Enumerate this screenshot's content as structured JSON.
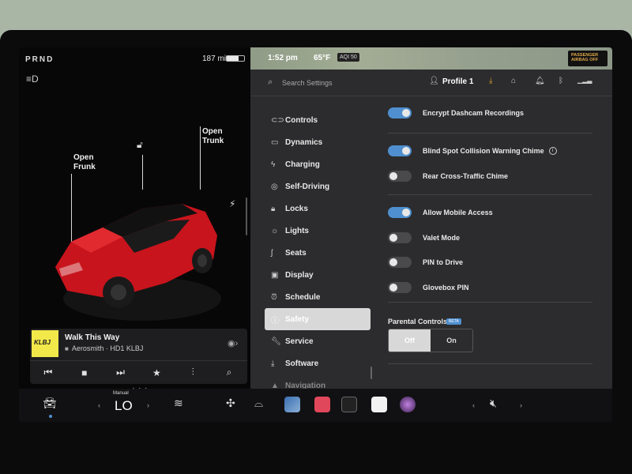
{
  "status": {
    "gear": "PRND",
    "range": "187 mi"
  },
  "car": {
    "frunk_label": "Open\nFrunk",
    "trunk_label": "Open\nTrunk"
  },
  "media": {
    "song": "Walk This Way",
    "artist": "Aerosmith · HD1 KLBJ",
    "album_text": "KLBJ"
  },
  "topbar": {
    "time": "1:52 pm",
    "temp": "65°F",
    "aqi": "AQI 50",
    "airbag": "PASSENGER\nAIRBAG OFF"
  },
  "settings": {
    "search_placeholder": "Search Settings",
    "profile": "Profile 1",
    "menu": [
      {
        "label": "Controls",
        "icon": "toggle-icon"
      },
      {
        "label": "Dynamics",
        "icon": "car-icon"
      },
      {
        "label": "Charging",
        "icon": "bolt-icon"
      },
      {
        "label": "Self-Driving",
        "icon": "steering-wheel-icon"
      },
      {
        "label": "Locks",
        "icon": "lock-icon"
      },
      {
        "label": "Lights",
        "icon": "sun-icon"
      },
      {
        "label": "Seats",
        "icon": "seat-icon"
      },
      {
        "label": "Display",
        "icon": "display-icon"
      },
      {
        "label": "Schedule",
        "icon": "clock-icon"
      },
      {
        "label": "Safety",
        "icon": "info-icon",
        "active": true
      },
      {
        "label": "Service",
        "icon": "wrench-icon"
      },
      {
        "label": "Software",
        "icon": "download-icon"
      },
      {
        "label": "Navigation",
        "icon": "navigation-icon"
      }
    ],
    "toggles": [
      {
        "label": "Encrypt Dashcam Recordings",
        "on": true
      },
      {
        "label": "Blind Spot Collision Warning Chime",
        "on": true
      },
      {
        "label": "Rear Cross-Traffic Chime",
        "on": false
      },
      {
        "label": "Allow Mobile Access",
        "on": true
      },
      {
        "label": "Valet Mode",
        "on": false
      },
      {
        "label": "PIN to Drive",
        "on": false
      },
      {
        "label": "Glovebox PIN",
        "on": false
      }
    ],
    "parental": {
      "title": "Parental Controls",
      "badge": "BETA",
      "off": "Off",
      "on": "On"
    }
  },
  "dock": {
    "climate_mode": "Manual",
    "climate_value": "LO"
  }
}
